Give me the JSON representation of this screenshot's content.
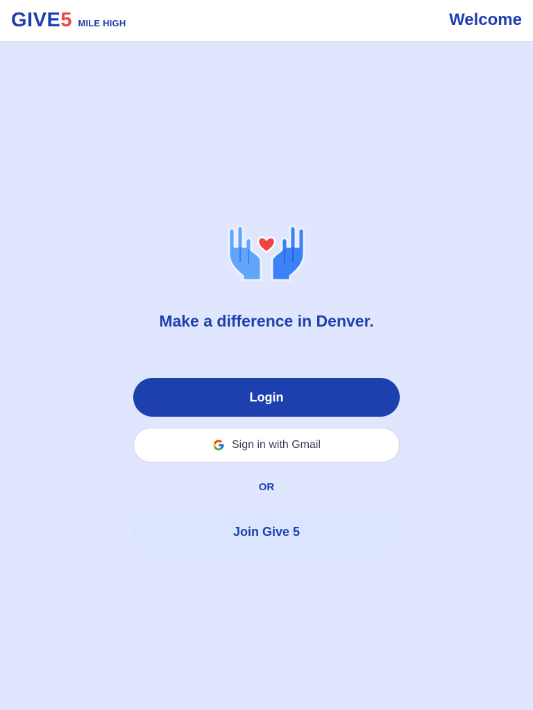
{
  "header": {
    "brand_give": "GIVE",
    "brand_five": "5",
    "brand_sub": "MILE HIGH",
    "title": "Welcome"
  },
  "hero": {
    "icon": "hands-heart-icon",
    "tagline": "Make a difference in Denver."
  },
  "actions": {
    "login_label": "Login",
    "gmail_label": "Sign in with Gmail",
    "gmail_icon": "google-icon",
    "or_label": "OR",
    "join_label": "Join Give 5"
  },
  "colors": {
    "primary": "#1e40af",
    "accent_red": "#ef4444",
    "background": "#e0e6fd",
    "join_button_bg": "#dbe6fe"
  }
}
